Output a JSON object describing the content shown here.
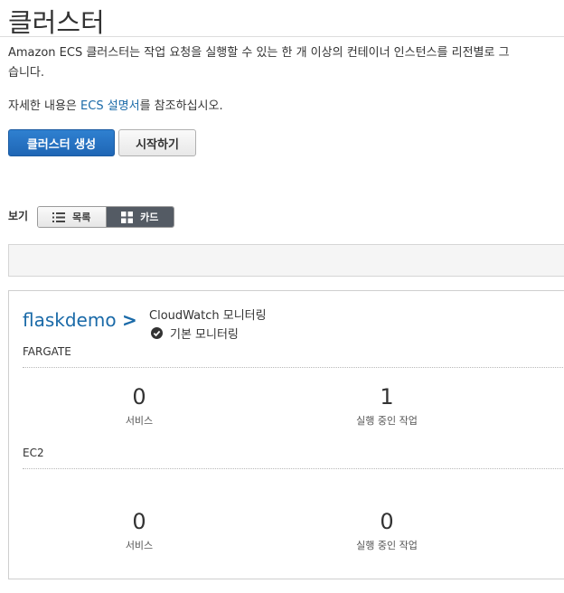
{
  "header": {
    "title": "클러스터"
  },
  "intro": {
    "line1": "Amazon ECS 클러스터는 작업 요청을 실행할 수 있는 한 개 이상의 컨테이너 인스턴스를 리전별로 그",
    "line2": "습니다."
  },
  "more_info": {
    "prefix": "자세한 내용은 ",
    "link": "ECS 설명서",
    "suffix": "를 참조하십시오."
  },
  "toolbar": {
    "create_label": "클러스터 생성",
    "start_label": "시작하기"
  },
  "view": {
    "label": "보기",
    "options": [
      {
        "label": "목록",
        "icon": "list-icon"
      },
      {
        "label": "카드",
        "icon": "grid-icon",
        "selected": true
      }
    ]
  },
  "cluster": {
    "name": "flaskdemo",
    "chevron": ">",
    "monitoring_title": "CloudWatch 모니터링",
    "monitoring_status": "기본 모니터링",
    "fargate": {
      "label": "FARGATE",
      "services_value": "0",
      "services_label": "서비스",
      "running_value": "1",
      "running_label": "실행 중인 작업"
    },
    "ec2": {
      "label": "EC2",
      "services_value": "0",
      "services_label": "서비스",
      "running_value": "0",
      "running_label": "실행 중인 작업"
    }
  },
  "colors": {
    "link": "#1a6aa8",
    "primary": "#1f66b5",
    "toggle_active": "#545b64"
  }
}
